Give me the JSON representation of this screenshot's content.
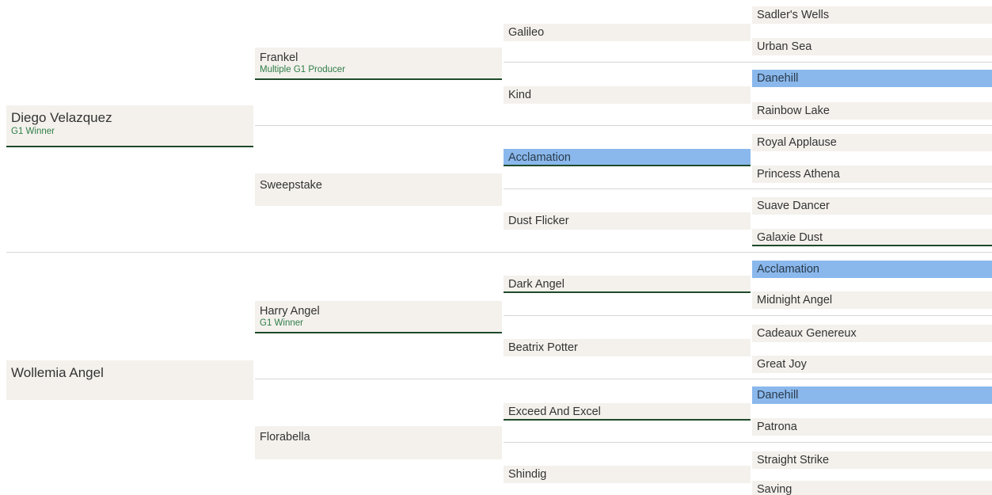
{
  "pedigree": {
    "gen1": [
      {
        "name": "Diego Velazquez",
        "note": "G1 Winner"
      },
      {
        "name": "Wollemia Angel",
        "note": ""
      }
    ],
    "gen2": [
      {
        "name": "Frankel",
        "note": "Multiple G1 Producer"
      },
      {
        "name": "Sweepstake",
        "note": ""
      },
      {
        "name": "Harry Angel",
        "note": "G1 Winner"
      },
      {
        "name": "Florabella",
        "note": ""
      }
    ],
    "gen3": [
      {
        "name": "Galileo"
      },
      {
        "name": "Kind"
      },
      {
        "name": "Acclamation"
      },
      {
        "name": "Dust Flicker"
      },
      {
        "name": "Dark Angel"
      },
      {
        "name": "Beatrix Potter"
      },
      {
        "name": "Exceed And Excel"
      },
      {
        "name": "Shindig"
      }
    ],
    "gen4": [
      {
        "name": "Sadler's Wells"
      },
      {
        "name": "Urban Sea"
      },
      {
        "name": "Danehill"
      },
      {
        "name": "Rainbow Lake"
      },
      {
        "name": "Royal Applause"
      },
      {
        "name": "Princess Athena"
      },
      {
        "name": "Suave Dancer"
      },
      {
        "name": "Galaxie Dust"
      },
      {
        "name": "Acclamation"
      },
      {
        "name": "Midnight Angel"
      },
      {
        "name": "Cadeaux Genereux"
      },
      {
        "name": "Great Joy"
      },
      {
        "name": "Danehill"
      },
      {
        "name": "Patrona"
      },
      {
        "name": "Straight Strike"
      },
      {
        "name": "Saving"
      }
    ],
    "colors": {
      "cell_bg": "#f4f1ed",
      "highlight": "#8ab8ec",
      "underline": "#1f4a2a",
      "note_text": "#2e7d46"
    }
  }
}
